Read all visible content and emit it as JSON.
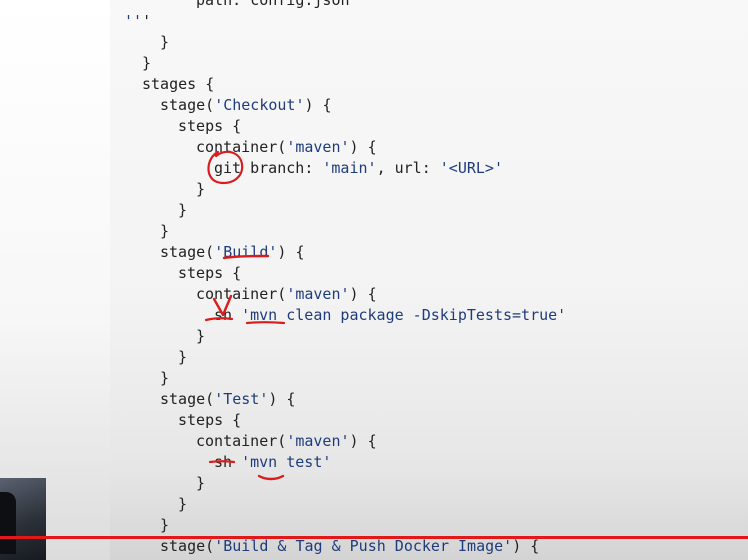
{
  "editor": {
    "lines": [
      {
        "text": "path: config.json",
        "indent": 4
      },
      {
        "text": "'''",
        "indent": 0
      },
      {
        "text": "}",
        "indent": 2
      },
      {
        "text": "}",
        "indent": 1
      },
      {
        "text": "stages {",
        "indent": 1
      },
      {
        "text": "stage('Checkout') {",
        "indent": 2
      },
      {
        "text": "steps {",
        "indent": 3
      },
      {
        "text": "container('maven') {",
        "indent": 4
      },
      {
        "text": "git branch: 'main', url: '<URL>'",
        "indent": 5
      },
      {
        "text": "}",
        "indent": 4
      },
      {
        "text": "}",
        "indent": 3
      },
      {
        "text": "}",
        "indent": 2
      },
      {
        "text": "stage('Build') {",
        "indent": 2
      },
      {
        "text": "steps {",
        "indent": 3
      },
      {
        "text": "container('maven') {",
        "indent": 4
      },
      {
        "text": "sh 'mvn clean package -DskipTests=true'",
        "indent": 5
      },
      {
        "text": "}",
        "indent": 4
      },
      {
        "text": "}",
        "indent": 3
      },
      {
        "text": "}",
        "indent": 2
      },
      {
        "text": "stage('Test') {",
        "indent": 2
      },
      {
        "text": "steps {",
        "indent": 3
      },
      {
        "text": "container('maven') {",
        "indent": 4
      },
      {
        "text": "sh 'mvn test'",
        "indent": 5
      },
      {
        "text": "}",
        "indent": 4
      },
      {
        "text": "}",
        "indent": 3
      },
      {
        "text": "}",
        "indent": 2
      },
      {
        "text": "stage('Build & Tag & Push Docker Image') {",
        "indent": 2
      }
    ]
  },
  "colors": {
    "string": "#1f3c7a",
    "keyword": "#0a7a7a",
    "text": "#222222",
    "annotation": "#d91c1c",
    "recording_line": "#e01818"
  },
  "icons": [
    "webcam-feed"
  ]
}
